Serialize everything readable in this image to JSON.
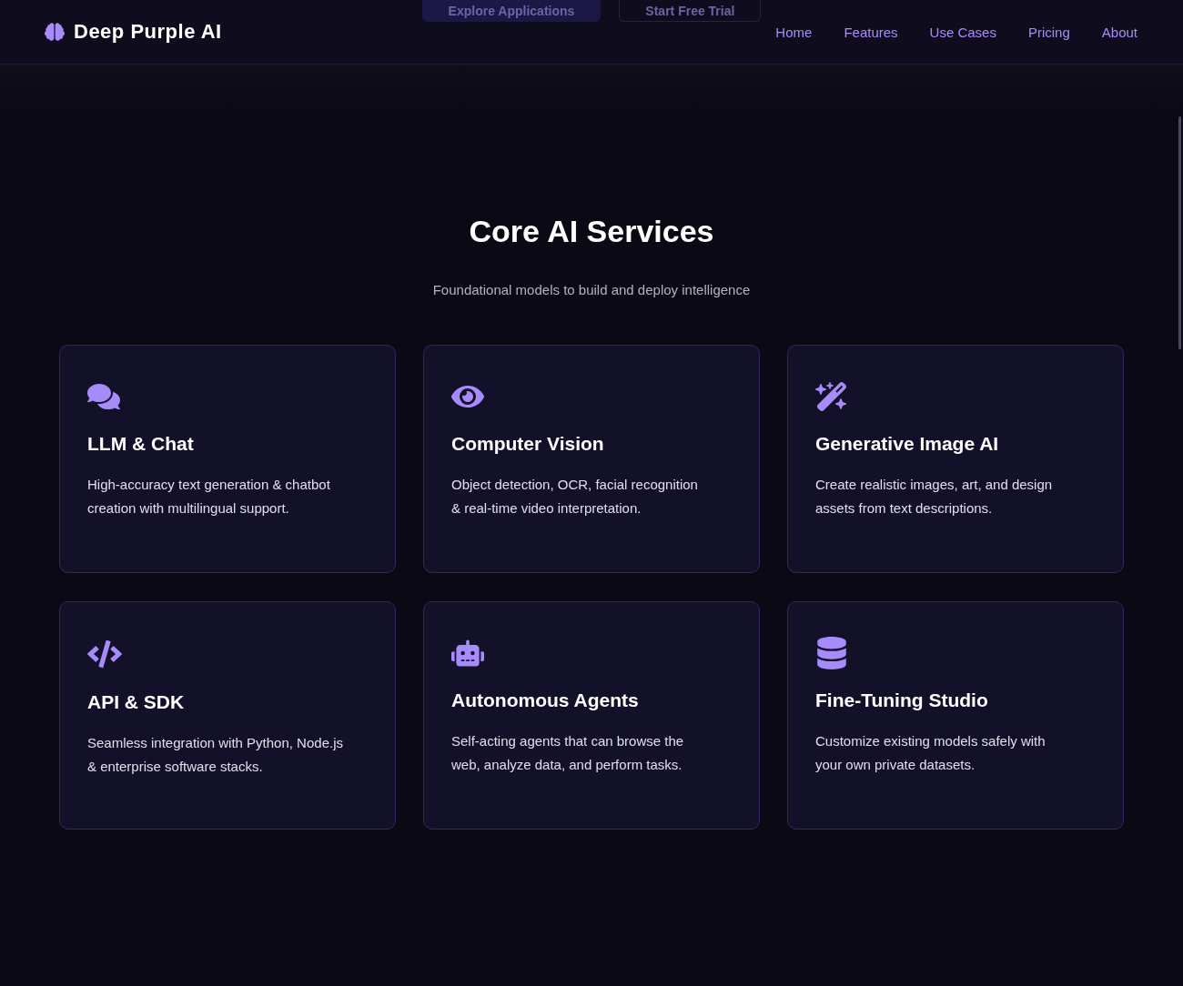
{
  "brand": "Deep Purple AI",
  "nav": [
    "Home",
    "Features",
    "Use Cases",
    "Pricing",
    "About"
  ],
  "hero_buttons": [
    "Explore Applications",
    "Start Free Trial"
  ],
  "section": {
    "title": "Core AI Services",
    "subtitle": "Foundational models to build and deploy intelligence"
  },
  "cards": [
    {
      "title": "LLM & Chat",
      "text": "High-accuracy text generation & chatbot creation with multilingual support."
    },
    {
      "title": "Computer Vision",
      "text": "Object detection, OCR, facial recognition & real-time video interpretation."
    },
    {
      "title": "Generative Image AI",
      "text": "Create realistic images, art, and design assets from text descriptions."
    },
    {
      "title": "API & SDK",
      "text": "Seamless integration with Python, Node.js & enterprise software stacks."
    },
    {
      "title": "Autonomous Agents",
      "text": "Self-acting agents that can browse the web, analyze data, and perform tasks."
    },
    {
      "title": "Fine-Tuning Studio",
      "text": "Customize existing models safely with your own private datasets."
    }
  ]
}
